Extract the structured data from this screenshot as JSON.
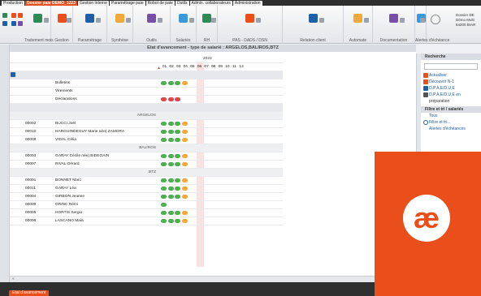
{
  "menu": {
    "tabs": [
      {
        "label": "Production",
        "active": false
      },
      {
        "label": "Dossier paie DEMO_1223",
        "active": true
      },
      {
        "label": "Gestion interne",
        "active": false
      },
      {
        "label": "Paramétrage paie",
        "active": false
      },
      {
        "label": "Robot de paie",
        "active": false
      },
      {
        "label": "Outils",
        "active": false
      },
      {
        "label": "Admin. collaborateurs",
        "active": false
      },
      {
        "label": "Administration",
        "active": false
      }
    ]
  },
  "ribbon": {
    "groups": [
      "Traitement mois",
      "Gestion",
      "Paramétrage",
      "Synthèse",
      "Outils",
      "Salariés",
      "RH",
      "PAS - DADS / DSN",
      "Relation client",
      "Automate",
      "Documentation",
      "Alertes d'échéance"
    ],
    "dossier_text": "Dossier DE\nDémo Multi\n64200 BIAR"
  },
  "main": {
    "title": "Etat d'avancement - type de salarié : ARGELOS,BALIROS,BTZ",
    "year": "2023",
    "months": [
      "01",
      "02",
      "03",
      "04",
      "05",
      "06",
      "07",
      "08",
      "09",
      "10",
      "11",
      "12"
    ],
    "rows": [
      {
        "type": "section",
        "code": "",
        "name": "",
        "group": "",
        "dots": []
      },
      {
        "type": "item",
        "code": "",
        "name": "Bulletins",
        "group": "",
        "dots": [
          "g",
          "g",
          "g",
          "o"
        ]
      },
      {
        "type": "item",
        "code": "",
        "name": "Virements",
        "group": "",
        "dots": []
      },
      {
        "type": "item",
        "code": "",
        "name": "Déclarations",
        "group": "",
        "dots": [
          "r",
          "r",
          "r"
        ]
      },
      {
        "type": "section",
        "code": "",
        "name": "",
        "group": "",
        "dots": []
      },
      {
        "type": "group",
        "code": "",
        "name": "",
        "group": "ARGELOS",
        "dots": []
      },
      {
        "type": "item",
        "code": "00002",
        "name": "BUCCI Joël",
        "group": "",
        "dots": [
          "g",
          "g",
          "g",
          "o"
        ]
      },
      {
        "type": "item",
        "code": "00010",
        "name": "HARGUINDEGUY Marie née) ZAMORA",
        "group": "",
        "dots": [
          "g",
          "g",
          "g",
          "o"
        ]
      },
      {
        "type": "item",
        "code": "00008",
        "name": "VIDAL Célia",
        "group": "",
        "dots": [
          "g",
          "g",
          "g",
          "o"
        ]
      },
      {
        "type": "group",
        "code": "",
        "name": "",
        "group": "BALIROS",
        "dots": []
      },
      {
        "type": "item",
        "code": "00003",
        "name": "GARAY Cécile née) BIDEGAIN",
        "group": "",
        "dots": [
          "g",
          "g",
          "g",
          "o"
        ]
      },
      {
        "type": "item",
        "code": "00007",
        "name": "RIVAL Gérard",
        "group": "",
        "dots": [
          "g",
          "g",
          "g",
          "o"
        ]
      },
      {
        "type": "group",
        "code": "",
        "name": "",
        "group": "BTZ",
        "dots": []
      },
      {
        "type": "item",
        "code": "00001",
        "name": "BONNET Marc",
        "group": "",
        "dots": [
          "g",
          "g",
          "g",
          "o"
        ]
      },
      {
        "type": "item",
        "code": "00011",
        "name": "GARAY Léa",
        "group": "",
        "dots": [
          "g",
          "g",
          "g",
          "o"
        ]
      },
      {
        "type": "item",
        "code": "00004",
        "name": "GIRBON Jeanne",
        "group": "",
        "dots": [
          "g",
          "g",
          "g",
          "o"
        ]
      },
      {
        "type": "item",
        "code": "00009",
        "name": "GRINC Rémi",
        "group": "",
        "dots": [
          "g"
        ]
      },
      {
        "type": "item",
        "code": "00005",
        "name": "HORTIS Sergio",
        "group": "",
        "dots": [
          "g",
          "g",
          "g",
          "o"
        ]
      },
      {
        "type": "item",
        "code": "00006",
        "name": "LASCANO Maia",
        "group": "",
        "dots": [
          "g",
          "g",
          "g",
          "o"
        ]
      }
    ],
    "scroll_left": "«"
  },
  "side": {
    "search_header": "Recherche",
    "actions": [
      {
        "label": "Actualiser",
        "icon": "refresh-icon",
        "color": "#e94e1b"
      },
      {
        "label": "Découvrir N-1",
        "icon": "discover-icon",
        "color": "#e94e1b"
      },
      {
        "label": "D.P.A.E/D.U.E",
        "icon": "document-icon",
        "color": "#1d5fa8"
      },
      {
        "label": "D.P.A.E/D.U.E en",
        "icon": "document-list-icon",
        "color": "#555555"
      },
      {
        "label": "préparation",
        "icon": "",
        "color": ""
      }
    ],
    "filter_header": "Filtre et tri / salariés",
    "filters": [
      {
        "label": "Tous",
        "icon": ""
      },
      {
        "label": "Filtre et tri...",
        "icon": "filter-icon"
      },
      {
        "label": "Alertes d'échéances",
        "icon": ""
      }
    ]
  },
  "promo": {
    "logo": "æ",
    "brand_color": "#e94e1b"
  },
  "bottom": {
    "tab": "Etat d'avancement"
  }
}
